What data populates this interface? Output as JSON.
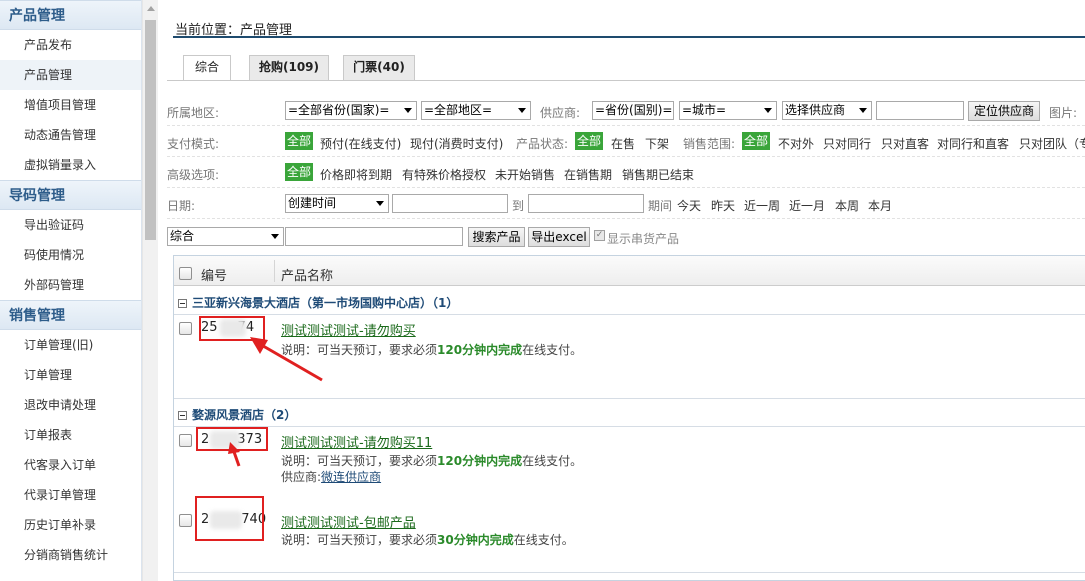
{
  "sidebar": {
    "sections": [
      {
        "title": "产品管理",
        "items": [
          "产品发布",
          "产品管理",
          "增值项目管理",
          "动态通告管理",
          "虚拟销量录入"
        ]
      },
      {
        "title": "导码管理",
        "items": [
          "导出验证码",
          "码使用情况",
          "外部码管理"
        ]
      },
      {
        "title": "销售管理",
        "items": [
          "订单管理(旧)",
          "订单管理",
          "退改申请处理",
          "订单报表",
          "代客录入订单",
          "代录订单管理",
          "历史订单补录",
          "分销商销售统计"
        ]
      }
    ]
  },
  "breadcrumb": "当前位置：产品管理",
  "tabs": [
    "综合",
    "抢购(109)",
    "门票(40)"
  ],
  "filters": {
    "region_label": "所属地区:",
    "province_select": "=全部省份(国家)=",
    "area_select": "=全部地区=",
    "supplier_label": "供应商:",
    "supplier_province": "=省份(国别)=",
    "supplier_city": "=城市=",
    "supplier_select": "选择供应商",
    "locate_button": "定位供应商",
    "image_label": "图片:",
    "pay_label": "支付模式:",
    "pay_options": [
      "全部",
      "预付(在线支付)",
      "现付(消费时支付)"
    ],
    "status_label": "产品状态:",
    "status_options": [
      "全部",
      "在售",
      "下架"
    ],
    "scope_label": "销售范围:",
    "scope_options": [
      "全部",
      "不对外",
      "只对同行",
      "只对直客",
      "对同行和直客",
      "只对团队（专"
    ],
    "adv_label": "高级选项:",
    "adv_options": [
      "全部",
      "价格即将到期",
      "有特殊价格授权",
      "未开始销售",
      "在销售期",
      "销售期已结束"
    ],
    "date_label": "日期:",
    "date_select": "创建时间",
    "date_to": "到",
    "date_quick": [
      "期间",
      "今天",
      "昨天",
      "近一周",
      "近一月",
      "本周",
      "本月"
    ],
    "keyword_select": "综合",
    "search_button": "搜索产品",
    "export_button": "导出excel",
    "show_serial_label": "显示串货产品"
  },
  "grid": {
    "col_id": "编号",
    "col_name": "产品名称",
    "groups": [
      {
        "title": "三亚新兴海景大酒店（第一市场国购中心店）（1）",
        "products": [
          {
            "id_start": "25",
            "id_end": "74",
            "name": "测试测试测试-请勿购买",
            "desc_pre": "说明：可当天预订，要求必须",
            "desc_num": "120分钟内完成",
            "desc_post": "在线支付。"
          }
        ]
      },
      {
        "title": "婺源风景酒店（2）",
        "products": [
          {
            "id_start": "2",
            "id_end": "373",
            "name": "测试测试测试-请勿购买11",
            "desc_pre": "说明：可当天预订，要求必须",
            "desc_num": "120分钟内完成",
            "desc_post": "在线支付。",
            "supplier_label": "供应商:",
            "supplier_name": "微连供应商"
          },
          {
            "id_start": "2",
            "id_end": "740",
            "name": "测试测试测试-包邮产品",
            "desc_pre": "说明：可当天预订，要求必须",
            "desc_num": "30分钟内完成",
            "desc_post": "在线支付。"
          }
        ]
      }
    ]
  },
  "colors": {
    "accent_green": "#3aa53a",
    "annotation_red": "#e02020",
    "nav_blue": "#2d5c8a"
  }
}
